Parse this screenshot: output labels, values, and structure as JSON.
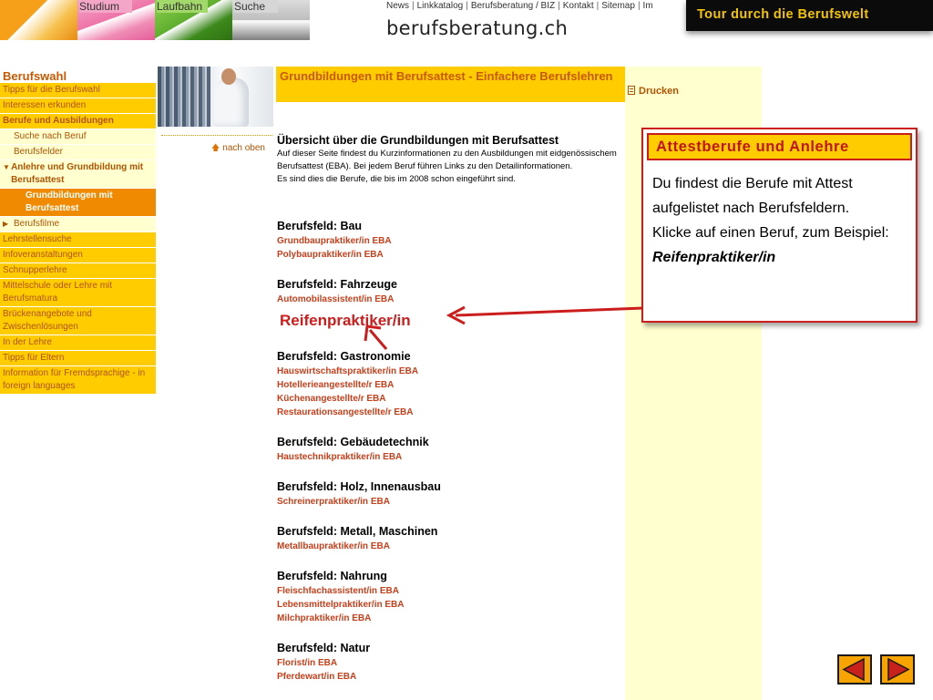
{
  "header": {
    "tabs": [
      {
        "label": ""
      },
      {
        "label": "Studium"
      },
      {
        "label": "Laufbahn"
      },
      {
        "label": "Suche"
      }
    ],
    "topnav": [
      "News",
      "Linkkatalog",
      "Berufsberatung / BIZ",
      "Kontakt",
      "Sitemap",
      "Im"
    ],
    "topnav_separator": "|",
    "site_title": "berufsberatung.ch",
    "tour_banner": "Tour durch die Berufswelt"
  },
  "sidebar": {
    "title": "Berufswahl",
    "items": [
      {
        "label": "Tipps für die Berufswahl"
      },
      {
        "label": "Interessen erkunden"
      },
      {
        "label": "Berufe und Ausbildungen"
      },
      {
        "label": "Suche nach Beruf"
      },
      {
        "label": "Berufsfelder"
      },
      {
        "label": "Anlehre und Grundbildung mit Berufsattest"
      },
      {
        "label": "Grundbildungen mit Berufsattest"
      },
      {
        "label": "Berufsfilme"
      },
      {
        "label": "Lehrstellensuche"
      },
      {
        "label": "Infoveranstaltungen"
      },
      {
        "label": "Schnupperlehre"
      },
      {
        "label": "Mittelschule oder Lehre mit Berufsmatura"
      },
      {
        "label": "Brückenangebote und Zwischenlösungen"
      },
      {
        "label": "In der Lehre"
      },
      {
        "label": "Tipps für Eltern"
      },
      {
        "label": "Information für Fremdsprachige - in foreign languages"
      }
    ]
  },
  "back_to_top": "nach oben",
  "main": {
    "page_title": "Grundbildungen mit Berufsattest - Einfachere Berufslehren",
    "overview_title": "Übersicht über die Grundbildungen mit Berufsattest",
    "overview_text_1": "Auf dieser Seite findest du Kurzinformationen zu den Ausbildungen mit eidgenössischem Berufsattest (EBA). Bei jedem Beruf führen Links zu den Detailinformationen.",
    "overview_text_2": "Es sind dies die Berufe, die bis im 2008 schon eingeführt sind.",
    "sections": [
      {
        "title": "Berufsfeld: Bau",
        "jobs": [
          "Grundbaupraktiker/in EBA",
          "Polybaupraktiker/in EBA"
        ]
      },
      {
        "title": "Berufsfeld: Fahrzeuge",
        "jobs": [
          "Automobilassistent/in EBA"
        ]
      },
      {
        "title": "Berufsfeld: Gastronomie",
        "jobs": [
          "Hauswirtschaftspraktiker/in EBA",
          "Hotellerieangestellte/r EBA",
          "Küchenangestellte/r EBA",
          "Restaurationsangestellte/r EBA"
        ]
      },
      {
        "title": "Berufsfeld: Gebäudetechnik",
        "jobs": [
          "Haustechnikpraktiker/in EBA"
        ]
      },
      {
        "title": "Berufsfeld: Holz, Innenausbau",
        "jobs": [
          "Schreinerpraktiker/in EBA"
        ]
      },
      {
        "title": "Berufsfeld: Metall, Maschinen",
        "jobs": [
          "Metallbaupraktiker/in EBA"
        ]
      },
      {
        "title": "Berufsfeld: Nahrung",
        "jobs": [
          "Fleischfachassistent/in EBA",
          "Lebensmittelpraktiker/in EBA",
          "Milchpraktiker/in EBA"
        ]
      },
      {
        "title": "Berufsfeld: Natur",
        "jobs": [
          "Florist/in EBA",
          "Pferdewart/in EBA"
        ]
      }
    ]
  },
  "print_label": "Drucken",
  "callout": {
    "title": "Attestberufe und Anlehre",
    "body_1": "Du findest die Berufe mit Attest aufgelistet nach Berufsfeldern.",
    "body_2": "Klicke auf einen Beruf, zum Beispiel:",
    "body_emph": "Reifenpraktiker/in"
  },
  "annotation_label": "Reifenpraktiker/in",
  "slide_nav": {
    "prev_icon": "triangle-left-icon",
    "next_icon": "triangle-right-icon"
  },
  "colors": {
    "accent_yellow": "#ffcc00",
    "pale_yellow": "#ffffd0",
    "orange_text": "#c75a00",
    "link_red": "#c8401b",
    "callout_red": "#cc1d1d",
    "banner_bg": "#0b0b0b",
    "banner_text": "#f3c400"
  }
}
